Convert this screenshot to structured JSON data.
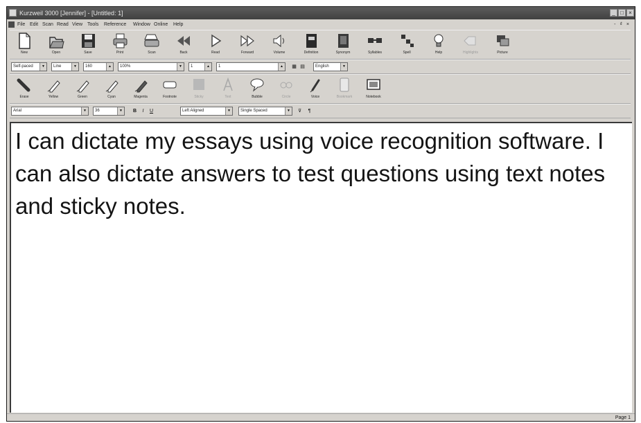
{
  "window": {
    "title": "Kurzweil 3000 [Jennifer] - [Untitled: 1]",
    "controls": [
      "_",
      "□",
      "×"
    ]
  },
  "menubar": {
    "items": [
      "File",
      "Edit",
      "Scan",
      "Read",
      "View",
      "Tools",
      "Reference",
      "Window",
      "Online",
      "Help"
    ],
    "right_controls": "- ₫ ×"
  },
  "toolbar_main": [
    {
      "label": "New",
      "icon": "new-document-icon"
    },
    {
      "label": "Open",
      "icon": "open-folder-icon"
    },
    {
      "label": "Save",
      "icon": "floppy-disk-icon"
    },
    {
      "label": "Print",
      "icon": "printer-icon"
    },
    {
      "label": "Scan",
      "icon": "scanner-icon"
    },
    {
      "label": "Back",
      "icon": "rewind-icon"
    },
    {
      "label": "Read",
      "icon": "play-icon"
    },
    {
      "label": "Forward",
      "icon": "fast-forward-icon"
    },
    {
      "label": "Volume",
      "icon": "speaker-icon"
    },
    {
      "label": "Definition",
      "icon": "dictionary-icon"
    },
    {
      "label": "Synonym",
      "icon": "synonym-book-icon"
    },
    {
      "label": "Syllables",
      "icon": "syllables-icon"
    },
    {
      "label": "Spell",
      "icon": "spell-icon"
    },
    {
      "label": "Help",
      "icon": "lightbulb-icon"
    },
    {
      "label": "Highlights",
      "icon": "highlights-icon",
      "disabled": true
    },
    {
      "label": "Picture",
      "icon": "picture-icon"
    }
  ],
  "reading_bar": {
    "reading_mode": "Self-paced",
    "reading_unit": "Line",
    "speed_value": "160",
    "zoom_value": "100%",
    "page_value": "1",
    "of_value": "1",
    "language": "English"
  },
  "toolbar_tools": [
    {
      "label": "Erase",
      "icon": "eraser-icon"
    },
    {
      "label": "Yellow",
      "icon": "highlighter-yellow-icon"
    },
    {
      "label": "Green",
      "icon": "highlighter-green-icon"
    },
    {
      "label": "Cyan",
      "icon": "highlighter-cyan-icon"
    },
    {
      "label": "Magenta",
      "icon": "highlighter-magenta-icon"
    },
    {
      "label": "Footnote",
      "icon": "footnote-icon"
    },
    {
      "label": "Sticky",
      "icon": "sticky-note-icon",
      "disabled": true
    },
    {
      "label": "Text",
      "icon": "text-note-icon",
      "disabled": true
    },
    {
      "label": "Bubble",
      "icon": "bubble-note-icon"
    },
    {
      "label": "Circle",
      "icon": "circle-icon",
      "disabled": true
    },
    {
      "label": "Voice",
      "icon": "voice-note-icon"
    },
    {
      "label": "Bookmark",
      "icon": "bookmark-icon",
      "disabled": true
    },
    {
      "label": "Notebook",
      "icon": "notebook-icon"
    }
  ],
  "format_bar": {
    "font": "Arial",
    "size": "36",
    "bold_label": "B",
    "italic_label": "I",
    "underline_label": "U",
    "alignment": "Left Aligned",
    "spacing": "Single Spaced"
  },
  "document": {
    "text": "I can dictate my essays using voice recognition software.  I can also dictate answers to test questions using text notes and sticky notes."
  },
  "status": {
    "page": "Page 1"
  }
}
